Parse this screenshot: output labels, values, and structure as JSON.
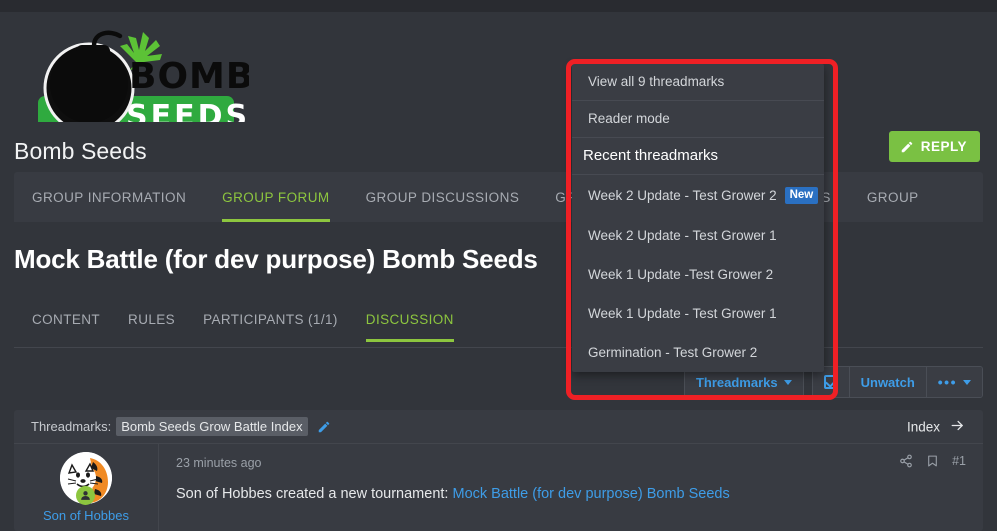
{
  "header": {
    "site_title": "Bomb Seeds",
    "logo_text_top": "BOMB",
    "logo_text_bottom": "SEEDS",
    "reply_label": "REPLY",
    "reply_icon": "pencil-icon",
    "reply_color": "#7ac143"
  },
  "nav_tabs": [
    {
      "label": "GROUP INFORMATION",
      "active": false
    },
    {
      "label": "GROUP FORUM",
      "active": true
    },
    {
      "label": "GROUP DISCUSSIONS",
      "active": false
    },
    {
      "label": "GROUP MEMBERS",
      "active": false
    },
    {
      "label": "GROUP EVENTS",
      "active": false
    },
    {
      "label": "GROUP",
      "active": false
    }
  ],
  "page": {
    "title": "Mock Battle (for dev purpose) Bomb Seeds"
  },
  "sub_tabs": [
    {
      "label": "CONTENT",
      "active": false
    },
    {
      "label": "RULES",
      "active": false
    },
    {
      "label": "PARTICIPANTS (1/1)",
      "active": false
    },
    {
      "label": "DISCUSSION",
      "active": true
    }
  ],
  "action_bar": {
    "threadmarks_label": "Threadmarks",
    "watch_checkbox_checked": true,
    "unwatch_label": "Unwatch",
    "more_label": "•••",
    "link_color": "#3e9de8"
  },
  "dropdown": {
    "view_all_label": "View all 9 threadmarks",
    "reader_mode_label": "Reader mode",
    "recent_header": "Recent threadmarks",
    "recent_items": [
      {
        "label": "Week 2 Update - Test Grower 2",
        "badge": "New"
      },
      {
        "label": "Week 2 Update - Test Grower 1",
        "badge": ""
      },
      {
        "label": "Week 1 Update -Test Grower 2",
        "badge": ""
      },
      {
        "label": "Week 1 Update - Test Grower 1",
        "badge": ""
      },
      {
        "label": "Germination - Test Grower 2",
        "badge": ""
      }
    ],
    "badge_color": "#2a70c2"
  },
  "annotation": {
    "box_color": "#ef2025"
  },
  "post_block": {
    "threadmarks_label": "Threadmarks:",
    "threadmarks_value": "Bomb Seeds Grow Battle Index",
    "edit_icon": "pencil-icon",
    "index_label": "Index",
    "index_icon": "arrow-right-icon",
    "poster_name": "Son of Hobbes",
    "timestamp": "23 minutes ago",
    "text_prefix": "Son of Hobbes created a new tournament: ",
    "text_link": "Mock Battle (for dev purpose) Bomb Seeds",
    "post_number": "#1",
    "share_icon": "share-icon",
    "bookmark_icon": "bookmark-icon"
  }
}
